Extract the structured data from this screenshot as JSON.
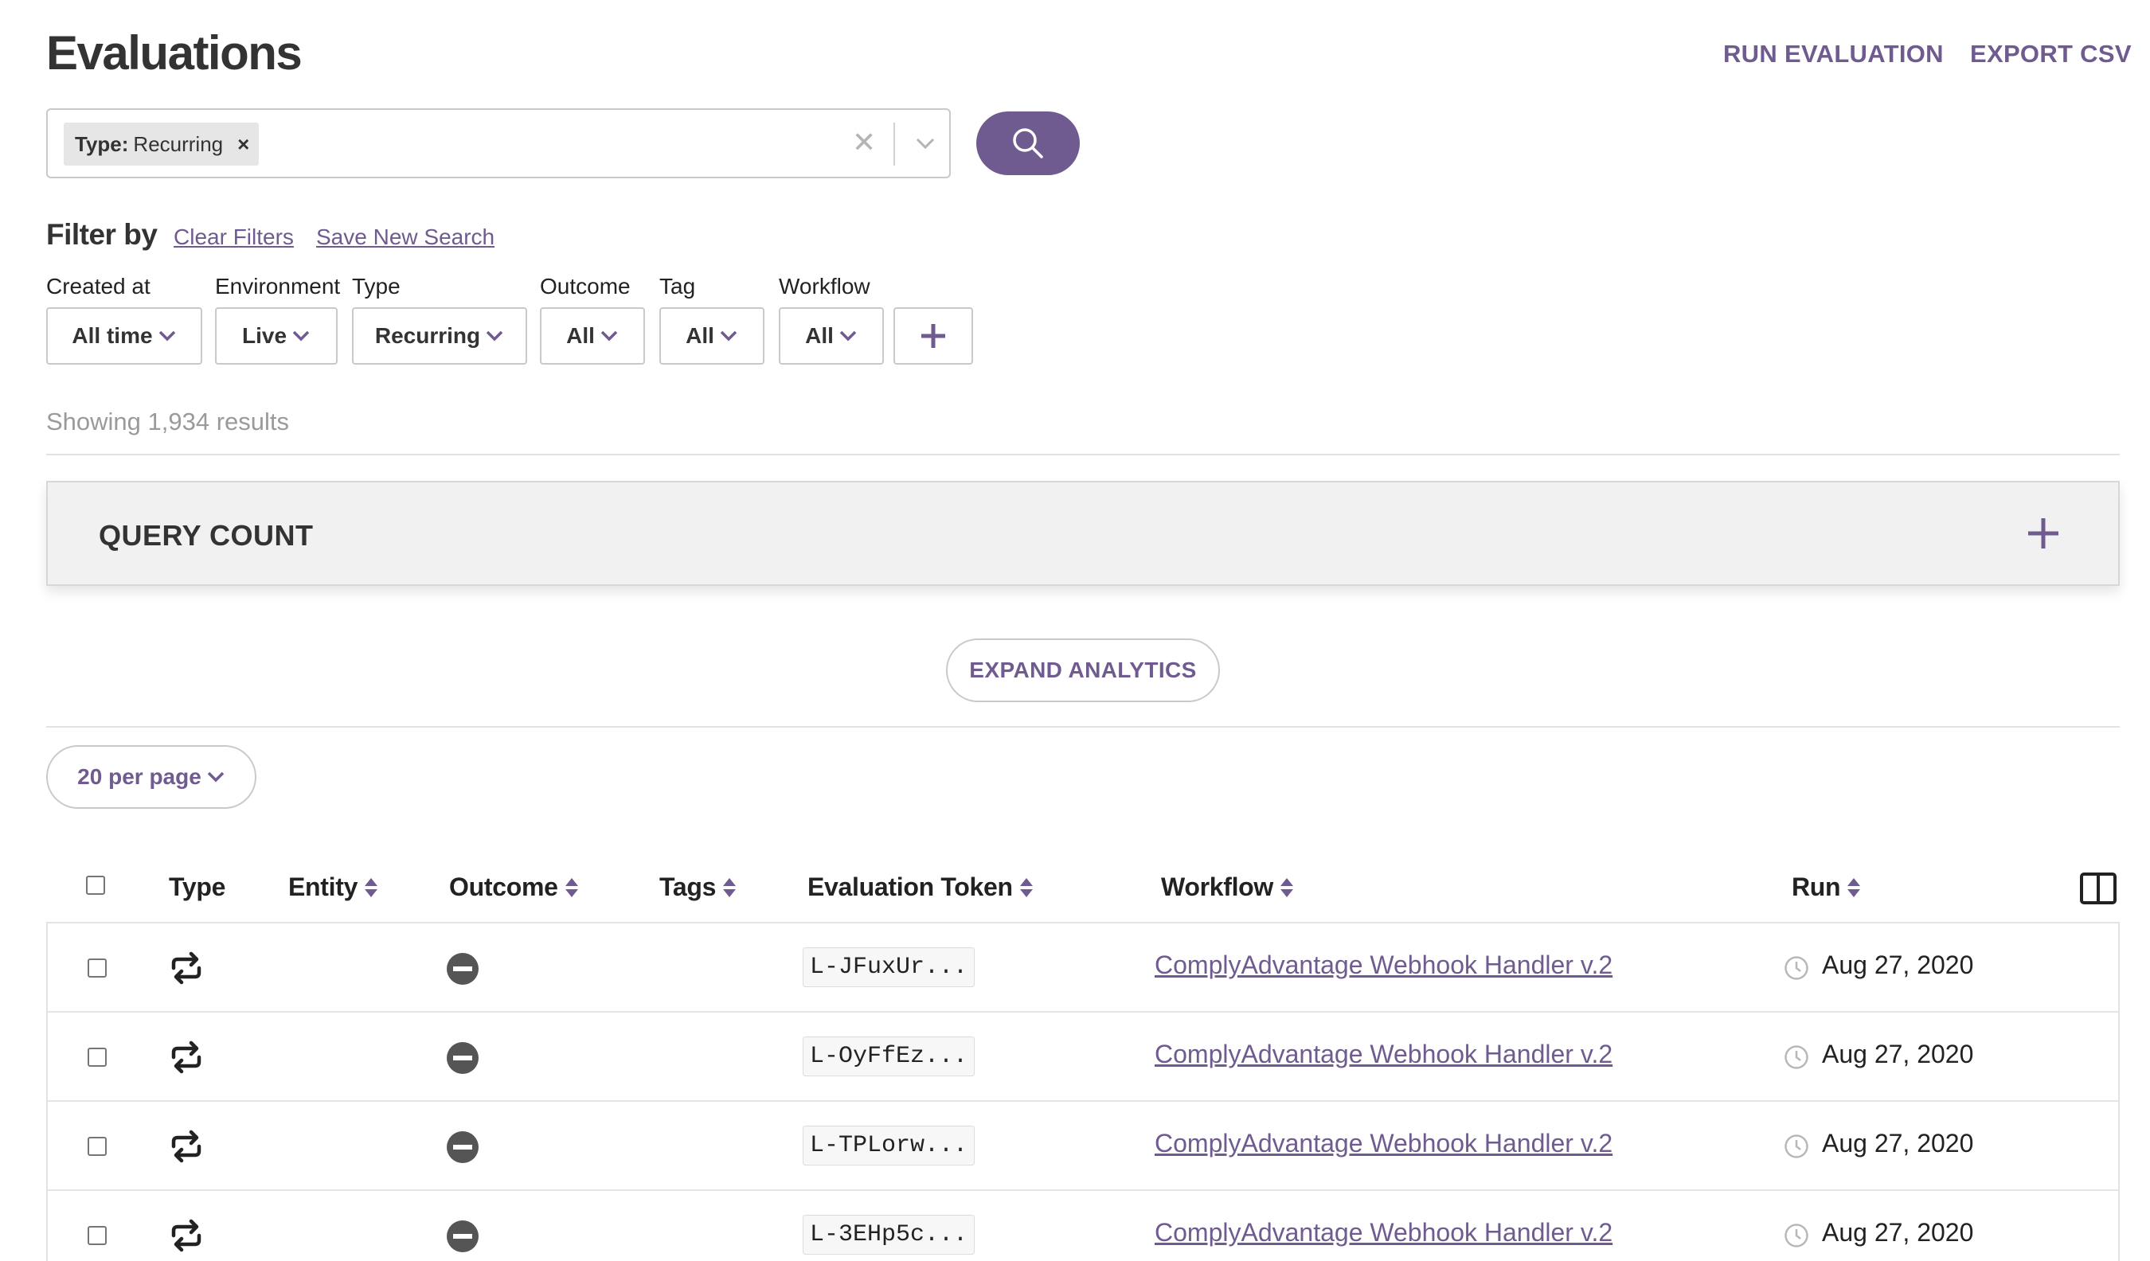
{
  "header": {
    "title": "Evaluations",
    "run_evaluation": "RUN EVALUATION",
    "export_csv": "EXPORT CSV"
  },
  "search": {
    "chip_key": "Type:",
    "chip_value": "Recurring",
    "chip_remove": "×",
    "clear_glyph": "✕"
  },
  "filters": {
    "heading": "Filter by",
    "clear_filters": "Clear Filters",
    "save_new_search": "Save New Search",
    "items": [
      {
        "label": "Created at",
        "value": "All time"
      },
      {
        "label": "Environment",
        "value": "Live"
      },
      {
        "label": "Type",
        "value": "Recurring"
      },
      {
        "label": "Outcome",
        "value": "All"
      },
      {
        "label": "Tag",
        "value": "All"
      },
      {
        "label": "Workflow",
        "value": "All"
      }
    ]
  },
  "results": {
    "showing": "Showing 1,934 results"
  },
  "query_count": {
    "title": "QUERY COUNT"
  },
  "analytics": {
    "expand_label": "EXPAND ANALYTICS"
  },
  "pagination": {
    "per_page": "20 per page"
  },
  "table": {
    "columns": {
      "type": "Type",
      "entity": "Entity",
      "outcome": "Outcome",
      "tags": "Tags",
      "token": "Evaluation Token",
      "workflow": "Workflow",
      "run": "Run"
    },
    "rows": [
      {
        "type_icon": "repeat-icon",
        "outcome_icon": "blocked-icon",
        "token": "L-JFuxUr...",
        "workflow": "ComplyAdvantage Webhook Handler v.2",
        "run": "Aug 27, 2020"
      },
      {
        "type_icon": "repeat-icon",
        "outcome_icon": "blocked-icon",
        "token": "L-OyFfEz...",
        "workflow": "ComplyAdvantage Webhook Handler v.2",
        "run": "Aug 27, 2020"
      },
      {
        "type_icon": "repeat-icon",
        "outcome_icon": "blocked-icon",
        "token": "L-TPLorw...",
        "workflow": "ComplyAdvantage Webhook Handler v.2",
        "run": "Aug 27, 2020"
      },
      {
        "type_icon": "repeat-icon",
        "outcome_icon": "blocked-icon",
        "token": "L-3EHp5c...",
        "workflow": "ComplyAdvantage Webhook Handler v.2",
        "run": "Aug 27, 2020"
      }
    ]
  },
  "colors": {
    "accent": "#6f5b8f",
    "text": "#222222",
    "muted": "#9a9a9a",
    "border": "#c9c9c9"
  }
}
